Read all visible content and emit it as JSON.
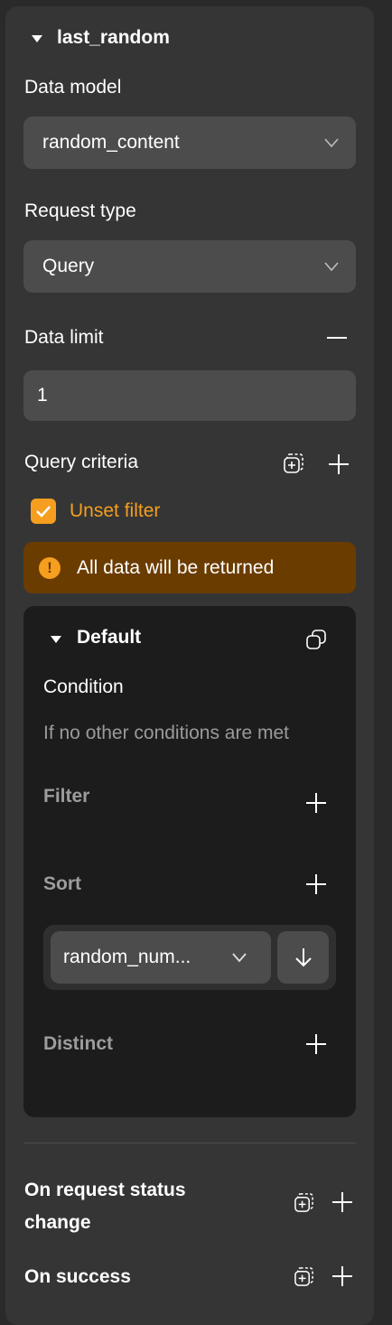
{
  "header": {
    "title": "last_random",
    "caret_icon": "triangle-down-icon"
  },
  "data_model": {
    "label": "Data model",
    "value": "random_content"
  },
  "request_type": {
    "label": "Request type",
    "value": "Query"
  },
  "data_limit": {
    "label": "Data limit",
    "value": "1"
  },
  "query_criteria": {
    "label": "Query criteria"
  },
  "unset_filter": {
    "label": "Unset filter",
    "checked": true,
    "accent": "#f59e1f"
  },
  "warning": {
    "text": "All data will be returned",
    "bg": "#6b3c00",
    "icon": "exclamation-icon"
  },
  "default_card": {
    "title": "Default",
    "condition_label": "Condition",
    "condition_text": "If no other conditions are met",
    "filter_label": "Filter",
    "sort_label": "Sort",
    "sort_field": "random_num...",
    "distinct_label": "Distinct"
  },
  "on_request_status_change": {
    "line1": "On request status",
    "line2": "change"
  },
  "on_success": {
    "label": "On success"
  }
}
